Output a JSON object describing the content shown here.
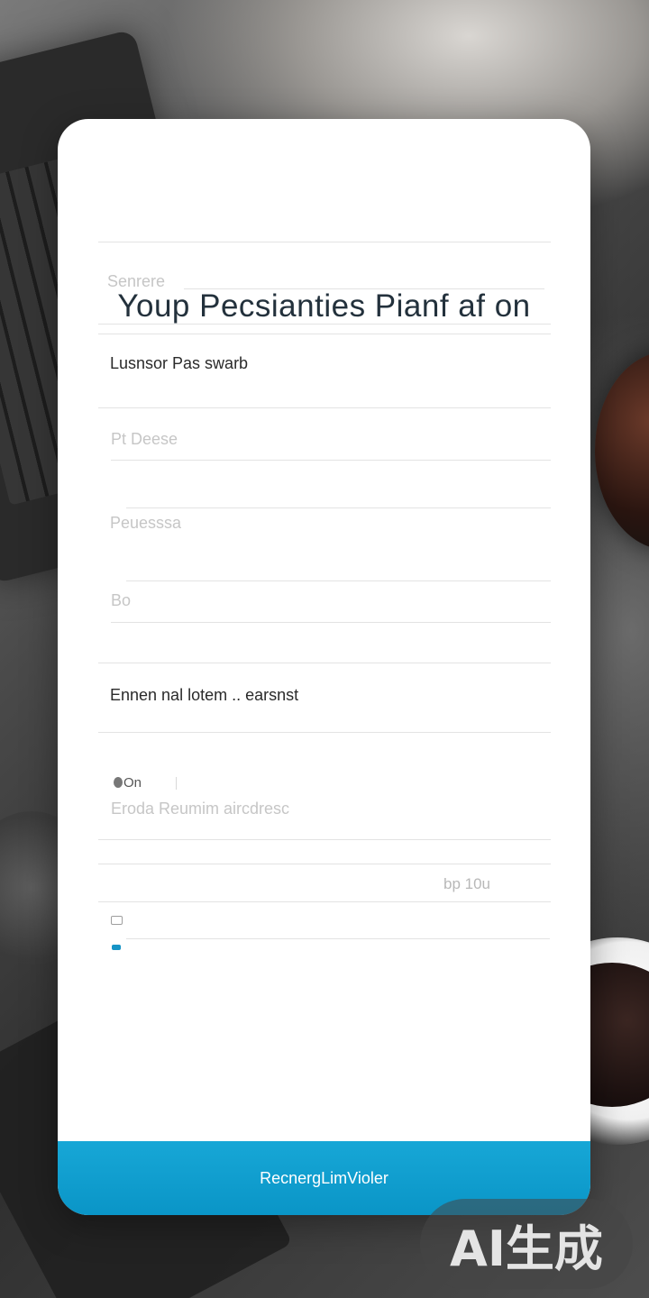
{
  "form": {
    "title": "Youp Pecsianties Pianf af on",
    "fields": [
      {
        "label": "Senrere"
      },
      {
        "label": "Lusnsor Pas swarb"
      },
      {
        "label": "Pt Deese"
      },
      {
        "label": "Peuesssa"
      },
      {
        "label": "Bo"
      },
      {
        "label": "Ennen nal lotem .. earsnst"
      },
      {
        "label": "Eroda Reumim aircdresc",
        "prefix": "On"
      },
      {
        "label": "bp 10u"
      }
    ],
    "submit_label": "RecnergLimVioler"
  },
  "watermark": {
    "text": "AI生成"
  }
}
